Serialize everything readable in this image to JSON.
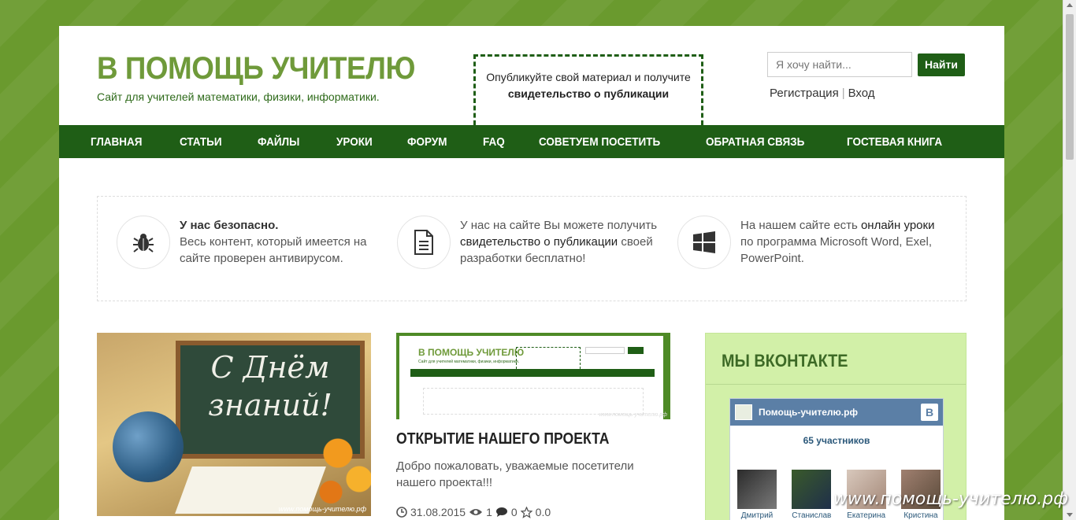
{
  "header": {
    "site_title": "В ПОМОЩЬ УЧИТЕЛЮ",
    "site_subtitle": "Сайт для учителей математики, физики, информатики.",
    "promo_line1": "Опубликуйте свой материал и получите",
    "promo_bold": "свидетельство о публикации",
    "search_placeholder": "Я хочу найти...",
    "search_button": "Найти",
    "register_link": "Регистрация",
    "login_link": "Вход",
    "separator": "|"
  },
  "nav": {
    "items": [
      "ГЛАВНАЯ",
      "СТАТЬИ",
      "ФАЙЛЫ",
      "УРОКИ",
      "ФОРУМ",
      "FAQ",
      "СОВЕТУЕМ ПОСЕТИТЬ",
      "ОБРАТНАЯ СВЯЗЬ",
      "ГОСТЕВАЯ КНИГА"
    ]
  },
  "features": [
    {
      "icon": "bug-icon",
      "bold": "У нас безопасно.",
      "text": "Весь контент, который имеется на сайте проверен антивирусом."
    },
    {
      "icon": "document-icon",
      "pre": "У нас на сайте Вы можете получить ",
      "hl": "свидетельство о публикации",
      "post": " своей разработки бесплатно!"
    },
    {
      "icon": "windows-icon",
      "pre": "На нашем сайте есть ",
      "hl": "онлайн уроки",
      "post": " по программа Microsoft Word, Exel, PowerPoint."
    }
  ],
  "posts": {
    "image1_text": "С Днём знаний!",
    "image1_watermark": "www.помощь-учителю.рф",
    "image2_title": "В ПОМОЩЬ УЧИТЕЛЮ",
    "image2_watermark": "www.помощь-учителю.рф",
    "title": "ОТКРЫТИЕ НАШЕГО ПРОЕКТА",
    "excerpt": "Добро пожаловать, уважаемые посетители нашего проекта!!!",
    "date": "31.08.2015",
    "views": "1",
    "comments": "0",
    "rating": "0.0"
  },
  "sidebar": {
    "heading": "МЫ ВКОНТАКТЕ",
    "vk_group_name": "Помощь-учителю.рф",
    "vk_logo": "В",
    "vk_members_count": "65 участников",
    "members": [
      {
        "name": "Дмитрий",
        "color": "#4a4a4a"
      },
      {
        "name": "Станислав",
        "color": "#3a5a2a"
      },
      {
        "name": "Екатерина",
        "color": "#c8b6a8"
      },
      {
        "name": "Кристина",
        "color": "#8a6a5a"
      }
    ]
  },
  "watermark": "www.помощь-учителю.рф",
  "colors": {
    "brand_green": "#1f5e16",
    "title_green": "#6f9a3a",
    "background": "#6a9a2e",
    "sidebar_bg": "#d2f0a8",
    "vk_blue": "#5b7fa6"
  }
}
